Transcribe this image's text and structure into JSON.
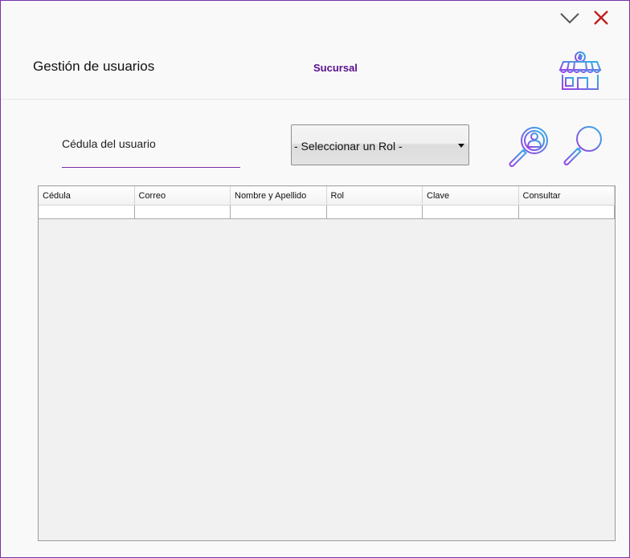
{
  "header": {
    "title": "Gestión de usuarios",
    "branch": "Sucursal"
  },
  "icons": {
    "minimize": "chevron-down-icon",
    "close": "close-icon",
    "store": "store-icon",
    "search_user": "search-user-icon",
    "search": "search-icon"
  },
  "filters": {
    "cedula_label": "Cédula del usuario",
    "cedula_value": "",
    "role_selected": "- Seleccionar un Rol -"
  },
  "table": {
    "columns": [
      "Cédula",
      "Correo",
      "Nombre y Apellido",
      "Rol",
      "Clave",
      "Consultar"
    ],
    "rows": [
      [
        "",
        "",
        "",
        "",
        "",
        ""
      ]
    ]
  },
  "colors": {
    "accent": "#7b2fa8",
    "branch_text": "#5b0f8f",
    "close": "#c41e1e",
    "icon_gradient_start": "#9b3fe6",
    "icon_gradient_end": "#2fb3e6"
  }
}
